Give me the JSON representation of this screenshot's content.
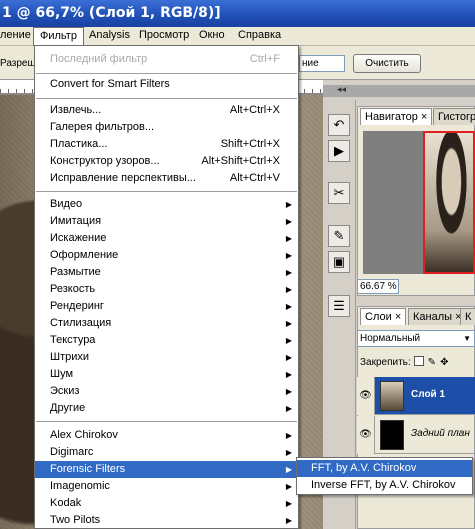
{
  "window": {
    "title": "1 @ 66,7% (Слой 1, RGB/8)]"
  },
  "menubar": {
    "items": [
      {
        "label": "ление"
      },
      {
        "label": "Фильтр"
      },
      {
        "label": "Analysis"
      },
      {
        "label": "Просмотр"
      },
      {
        "label": "Окно"
      },
      {
        "label": "Справка"
      }
    ]
  },
  "options_bar": {
    "left_label": "Разреш",
    "field_value": "ние",
    "clear_button": "Очистить"
  },
  "filter_menu": {
    "last_filter": {
      "label": "Последний фильтр",
      "shortcut": "Ctrl+F"
    },
    "smart": {
      "label": "Convert for Smart Filters"
    },
    "group1": [
      {
        "label": "Извлечь...",
        "shortcut": "Alt+Ctrl+X"
      },
      {
        "label": "Галерея фильтров...",
        "shortcut": ""
      },
      {
        "label": "Пластика...",
        "shortcut": "Shift+Ctrl+X"
      },
      {
        "label": "Конструктор узоров...",
        "shortcut": "Alt+Shift+Ctrl+X"
      },
      {
        "label": "Исправление перспективы...",
        "shortcut": "Alt+Ctrl+V"
      }
    ],
    "group2": [
      "Видео",
      "Имитация",
      "Искажение",
      "Оформление",
      "Размытие",
      "Резкость",
      "Рендеринг",
      "Стилизация",
      "Текстура",
      "Штрихи",
      "Шум",
      "Эскиз",
      "Другие"
    ],
    "group3": [
      "Alex Chirokov",
      "Digimarc",
      "Forensic Filters",
      "Imagenomic",
      "Kodak",
      "Two Pilots"
    ],
    "highlighted": "Forensic Filters"
  },
  "forensic_submenu": {
    "items": [
      {
        "label": "FFT, by A.V. Chirokov"
      },
      {
        "label": "Inverse FFT, by A.V. Chirokov"
      }
    ],
    "highlighted": "FFT, by A.V. Chirokov"
  },
  "navigator_panel": {
    "tabs": [
      "Навигатор",
      "Гистогр"
    ],
    "zoom": "66.67 %"
  },
  "layers_panel": {
    "tabs": [
      "Слои",
      "Каналы",
      "К"
    ],
    "blend_mode": "Нормальный",
    "lock_label": "Закрепить:",
    "layers": [
      {
        "name": "Слой 1",
        "selected": true
      },
      {
        "name": "Задний план",
        "selected": false
      }
    ]
  },
  "colors": {
    "accent": "#316ac5",
    "title_bar": "#1f4fb5",
    "selected_layer": "#1e4fa8"
  }
}
